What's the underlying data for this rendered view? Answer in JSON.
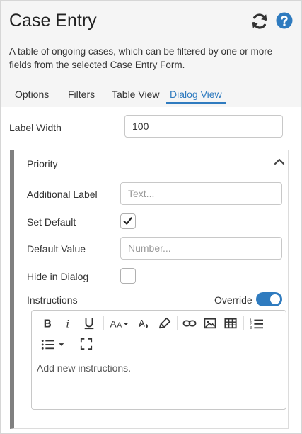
{
  "header": {
    "title": "Case Entry",
    "description": "A table of ongoing cases, which can be filtered by one or more fields from the selected Case Entry Form.",
    "refresh_icon": "refresh-icon",
    "help_icon": "question-circle-icon",
    "accent_color": "#2f7bbf"
  },
  "tabs": [
    {
      "label": "Options"
    },
    {
      "label": "Filters"
    },
    {
      "label": "Table View"
    },
    {
      "label": "Dialog View"
    }
  ],
  "active_tab": "Dialog View",
  "label_width": {
    "label": "Label Width",
    "value": "100"
  },
  "field_card": {
    "name": "Priority",
    "additional_label": {
      "label": "Additional Label",
      "placeholder": "Text..."
    },
    "set_default": {
      "label": "Set Default",
      "checked": true
    },
    "default_value": {
      "label": "Default Value",
      "placeholder": "Number..."
    },
    "hide_in_dialog": {
      "label": "Hide in Dialog",
      "checked": false
    },
    "instructions": {
      "label": "Instructions",
      "override_label": "Override",
      "override_on": true,
      "placeholder": "Add new instructions."
    }
  },
  "toolbar_icons": [
    "bold-icon",
    "italic-icon",
    "underline-icon",
    "font-size-icon",
    "font-color-icon",
    "highlight-icon",
    "link-icon",
    "image-icon",
    "table-icon",
    "ordered-list-icon",
    "unordered-list-icon",
    "fullscreen-icon"
  ]
}
